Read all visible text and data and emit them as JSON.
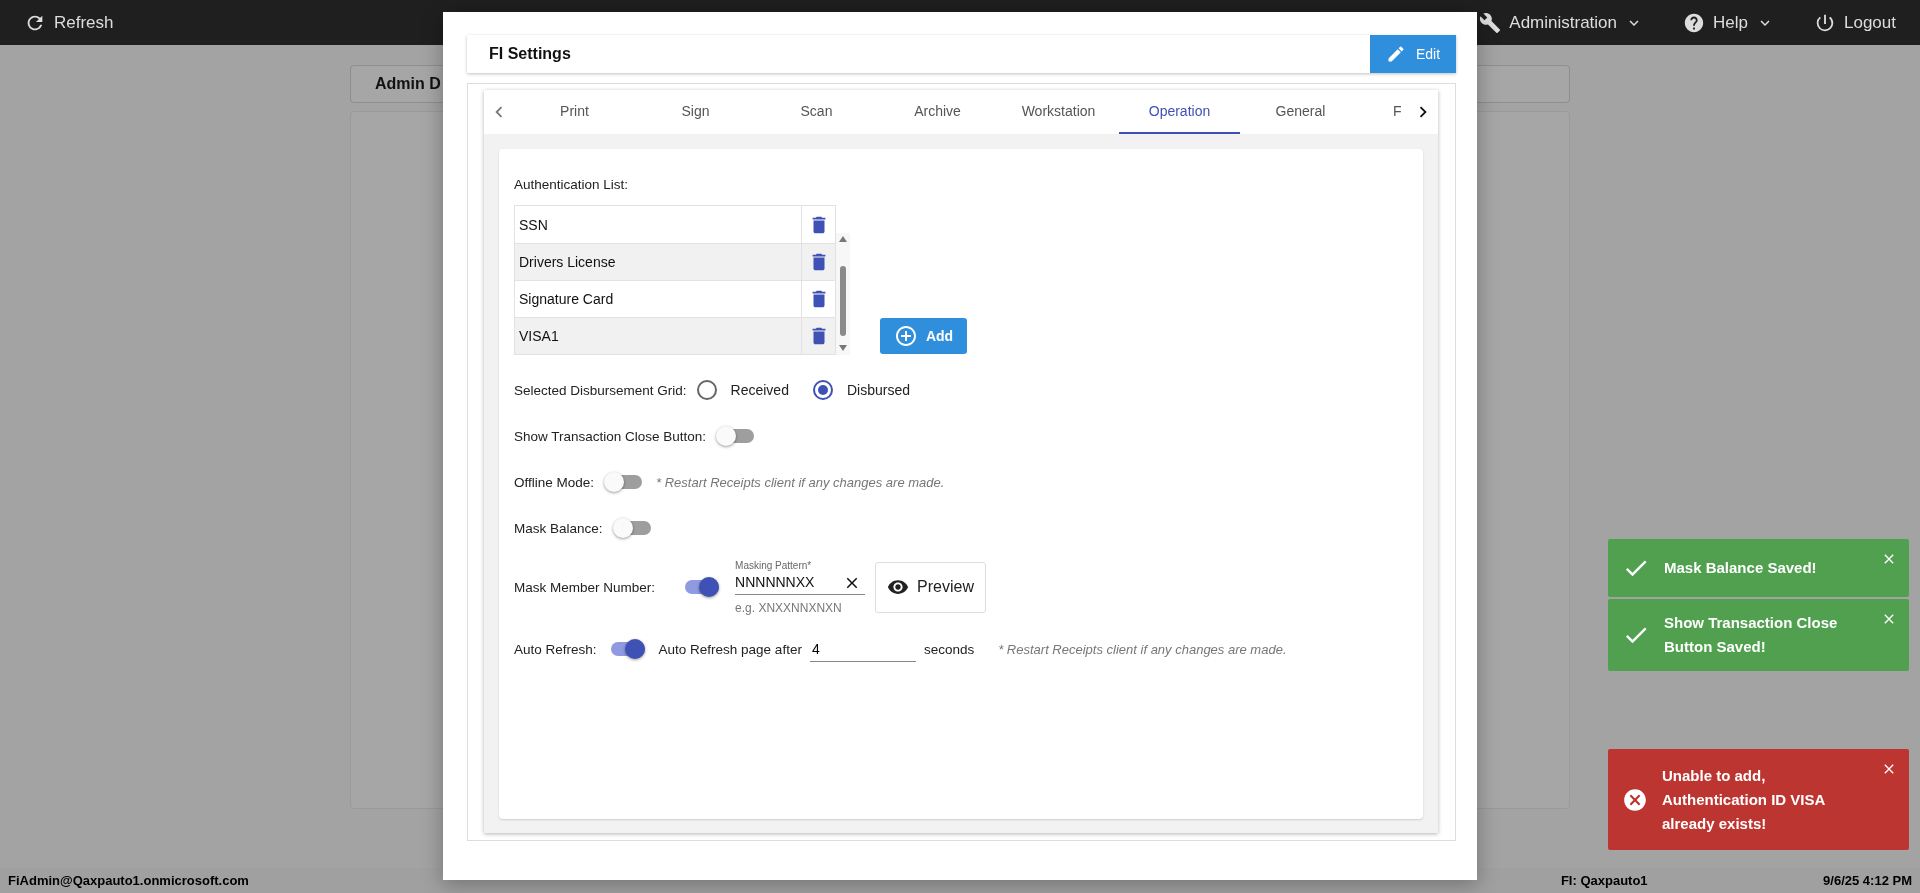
{
  "top_bar": {
    "refresh": "Refresh",
    "menus": [
      {
        "label": "Administration",
        "dropdown": true
      },
      {
        "label": "Help",
        "dropdown": true
      },
      {
        "label": "Logout",
        "dropdown": false
      }
    ]
  },
  "background": {
    "panel_title": "Admin D"
  },
  "modal": {
    "title": "FI Settings",
    "edit_button": "Edit",
    "tabs": [
      {
        "label": "Print",
        "selected": false
      },
      {
        "label": "Sign",
        "selected": false
      },
      {
        "label": "Scan",
        "selected": false
      },
      {
        "label": "Archive",
        "selected": false
      },
      {
        "label": "Workstation",
        "selected": false
      },
      {
        "label": "Operation",
        "selected": true
      },
      {
        "label": "General",
        "selected": false
      },
      {
        "label": "F",
        "selected": false
      }
    ],
    "auth_list": {
      "label": "Authentication List:",
      "items": [
        "SSN",
        "Drivers License",
        "Signature Card",
        "VISA1"
      ],
      "add_button": "Add"
    },
    "disbursement": {
      "label": "Selected Disbursement Grid:",
      "options": [
        {
          "label": "Received",
          "selected": false
        },
        {
          "label": "Disbursed",
          "selected": true
        }
      ]
    },
    "settings": [
      {
        "kind": "toggle",
        "label": "Show Transaction Close Button:",
        "on": false
      },
      {
        "kind": "toggle",
        "label": "Offline Mode:",
        "on": false,
        "note": "* Restart Receipts client if any changes are made."
      },
      {
        "kind": "toggle",
        "label": "Mask Balance:",
        "on": false
      },
      {
        "kind": "pattern",
        "label": "Mask Member Number:",
        "on": true,
        "field_label": "Masking Pattern*",
        "value": "NNNNNNXX",
        "hint": "e.g. XNXXNNXNXN",
        "button": "Preview"
      },
      {
        "kind": "refresh",
        "label": "Auto Refresh:",
        "on": true,
        "prefix": "Auto Refresh page after",
        "value": "4",
        "suffix": "seconds",
        "note": "* Restart Receipts client if any changes are made."
      }
    ]
  },
  "toasts": [
    {
      "kind": "success",
      "message": "Mask Balance Saved!"
    },
    {
      "kind": "success",
      "message": "Show Transaction Close Button Saved!"
    },
    {
      "kind": "error",
      "message": "Unable to add, Authentication ID VISA already exists!"
    }
  ],
  "status_bar": {
    "user": "FiAdmin@Qaxpauto1.onmicrosoft.com",
    "fi": "FI: Qaxpauto1",
    "datetime": "9/6/25 4:12 PM"
  }
}
